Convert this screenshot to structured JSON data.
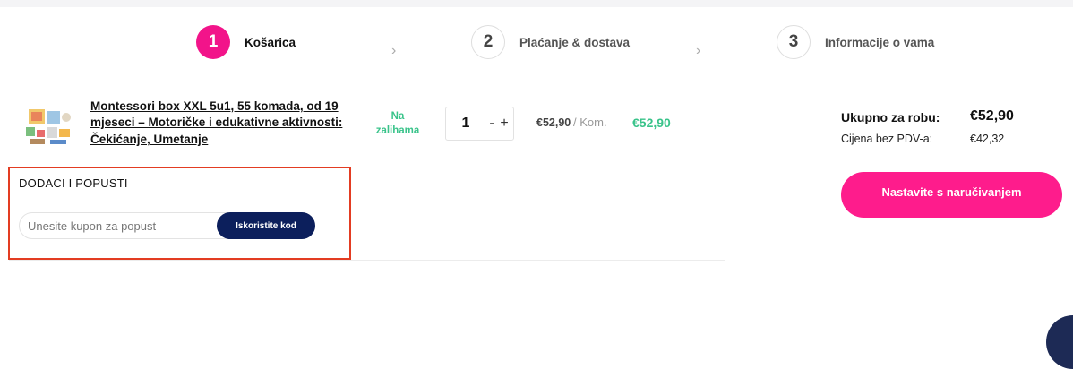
{
  "steps": [
    {
      "number": "1",
      "label": "Košarica"
    },
    {
      "number": "2",
      "label": "Plaćanje & dostava"
    },
    {
      "number": "3",
      "label": "Informacije o vama"
    }
  ],
  "icons": {
    "step_separator": "chevron-right-icon",
    "product_image": "product-thumbnail"
  },
  "cart": {
    "item": {
      "title": "Montessori box XXL 5u1, 55 komada, od 19 mjeseci – Motoričke i edukativne aktivnosti: Čekićanje, Umetanje",
      "stock": "Na zalihama",
      "quantity": "1",
      "minus": "-",
      "plus": "+",
      "unit_price": "€52,90",
      "unit_suffix": "/ Kom.",
      "total": "€52,90"
    }
  },
  "promo": {
    "heading": "DODACI I POPUSTI",
    "placeholder": "Unesite kupon za popust",
    "button": "Iskoristite kod"
  },
  "summary": {
    "total_label": "Ukupno za robu:",
    "total_value": "€52,90",
    "net_label": "Cijena bez PDV-a:",
    "net_value": "€42,32",
    "checkout_button": "Nastavite s naručivanjem"
  },
  "colors": {
    "accent": "#f2148a",
    "stock_green": "#39c38a",
    "navy": "#0c1f5c",
    "highlight_border": "#e33c22"
  }
}
